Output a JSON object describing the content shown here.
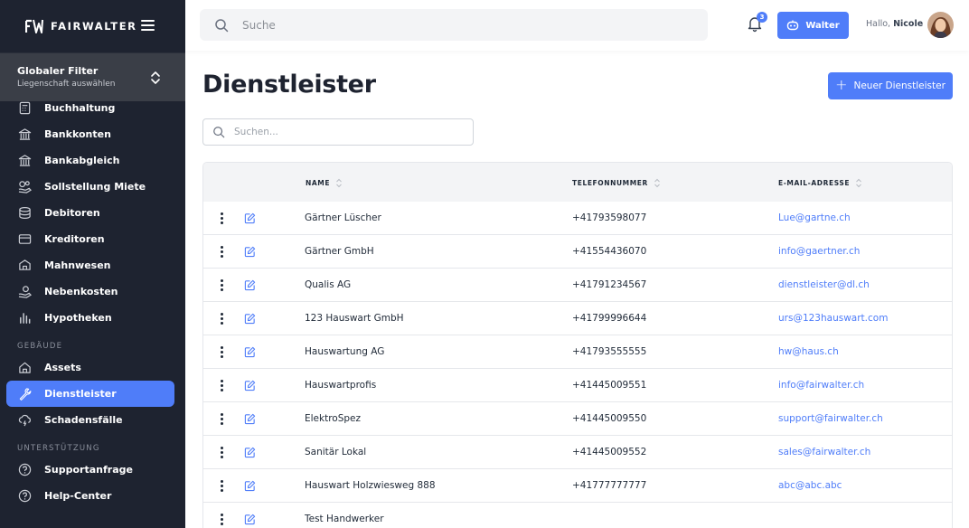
{
  "brand": {
    "name": "FAIRWALTER"
  },
  "global_filter": {
    "title": "Globaler Filter",
    "subtitle": "Liegenschaft auswählen"
  },
  "nav": {
    "finance_items": [
      {
        "label": "Buchhaltung",
        "icon": "calculator-icon"
      },
      {
        "label": "Bankkonten",
        "icon": "bank-icon"
      },
      {
        "label": "Bankabgleich",
        "icon": "bank-icon"
      },
      {
        "label": "Sollstellung Miete",
        "icon": "hand-coins-icon"
      },
      {
        "label": "Debitoren",
        "icon": "coins-icon"
      },
      {
        "label": "Kreditoren",
        "icon": "credit-card-icon"
      },
      {
        "label": "Mahnwesen",
        "icon": "reminder-icon"
      },
      {
        "label": "Nebenkosten",
        "icon": "hand-money-icon"
      },
      {
        "label": "Hypotheken",
        "icon": "bar-chart-icon"
      }
    ],
    "section_building": "GEBÄUDE",
    "building_items": [
      {
        "label": "Assets",
        "icon": "home-icon"
      },
      {
        "label": "Dienstleister",
        "icon": "wrench-icon"
      },
      {
        "label": "Schadensfälle",
        "icon": "storm-cloud-icon"
      }
    ],
    "section_support": "UNTERSTÜTZUNG",
    "support_items": [
      {
        "label": "Supportanfrage",
        "icon": "question-icon"
      },
      {
        "label": "Help-Center",
        "icon": "question-icon"
      }
    ]
  },
  "header": {
    "search_placeholder": "Suche",
    "notification_count": "3",
    "walter_button": "Walter",
    "greeting": "Hallo,",
    "user_name": "Nicole"
  },
  "main": {
    "title": "Dienstleister",
    "new_button": "Neuer Dienstleister",
    "search_placeholder": "Suchen...",
    "columns": {
      "name": "NAME",
      "phone": "TELEFONNUMMER",
      "email": "E-MAIL-ADRESSE"
    },
    "rows": [
      {
        "name": "Gärtner Lüscher",
        "phone": "+41793598077",
        "email": "Lue@gartne.ch"
      },
      {
        "name": "Gärtner GmbH",
        "phone": "+41554436070",
        "email": "info@gaertner.ch"
      },
      {
        "name": "Qualis AG",
        "phone": "+41791234567",
        "email": "dienstleister@dl.ch"
      },
      {
        "name": "123 Hauswart GmbH",
        "phone": "+41799996644",
        "email": "urs@123hauswart.com"
      },
      {
        "name": "Hauswartung AG",
        "phone": "+41793555555",
        "email": "hw@haus.ch"
      },
      {
        "name": "Hauswartprofis",
        "phone": "+41445009551",
        "email": "info@fairwalter.ch"
      },
      {
        "name": "ElektroSpez",
        "phone": "+41445009550",
        "email": "support@fairwalter.ch"
      },
      {
        "name": "Sanitär Lokal",
        "phone": "+41445009552",
        "email": "sales@fairwalter.ch"
      },
      {
        "name": "Hauswart Holzwiesweg 888",
        "phone": "+41777777777",
        "email": "abc@abc.abc"
      },
      {
        "name": "Test Handwerker",
        "phone": "",
        "email": ""
      }
    ]
  },
  "colors": {
    "sidebar_bg": "#1e2330",
    "accent": "#4f7df9",
    "filter_bg": "#3a3e47"
  }
}
